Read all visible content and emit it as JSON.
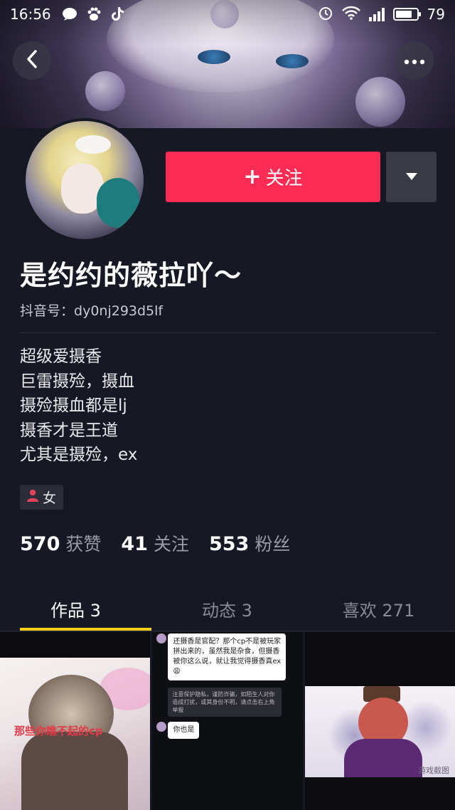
{
  "status_bar": {
    "time": "16:56",
    "battery": "79",
    "battery_level": 0.79,
    "left_icons": [
      "chat-bubble-icon",
      "paw-icon",
      "tiktok-icon"
    ],
    "right_icons": [
      "alarm-icon",
      "wifi-icon",
      "signal-icon",
      "battery-icon"
    ]
  },
  "header": {
    "back_icon": "chevron-left-icon",
    "more_icon": "more-dots-icon"
  },
  "profile": {
    "follow_label": "关注",
    "follow_icon": "plus-icon",
    "dropdown_icon": "caret-down-icon",
    "nickname": "是约约的薇拉吖～",
    "id_label": "抖音号：",
    "id_value": "dy0nj293d5lf",
    "bio": [
      "超级爱摄香",
      "巨雷摄殓，摄血",
      "摄殓摄血都是lj",
      "摄香才是王道",
      "尤其是摄殓，ex"
    ],
    "gender": "女",
    "gender_icon": "person-icon"
  },
  "stats": [
    {
      "num": "570",
      "label": "获赞"
    },
    {
      "num": "41",
      "label": "关注"
    },
    {
      "num": "553",
      "label": "粉丝"
    }
  ],
  "tabs": [
    {
      "label": "作品 3",
      "active": true
    },
    {
      "label": "动态 3",
      "active": false
    },
    {
      "label": "喜欢 271",
      "active": false
    }
  ],
  "grid": {
    "post1_caption": "那些你瞧不起的cp",
    "post2_msg1": "还摄香是官配？那个cp不是被玩家拼出来的，虽然我是杂食，但摄香被你这么说，就让我觉得摄香真ex😩",
    "post2_sys": "注意保护隐私，谨防诈骗，如陌生人对你造成打扰，或其身份不明，请点击右上角举报",
    "post2_msg2": "你也是",
    "post3_caption": "游戏截图"
  },
  "colors": {
    "background": "#161823",
    "follow_button": "#fe2c55",
    "tab_indicator": "#face15"
  }
}
